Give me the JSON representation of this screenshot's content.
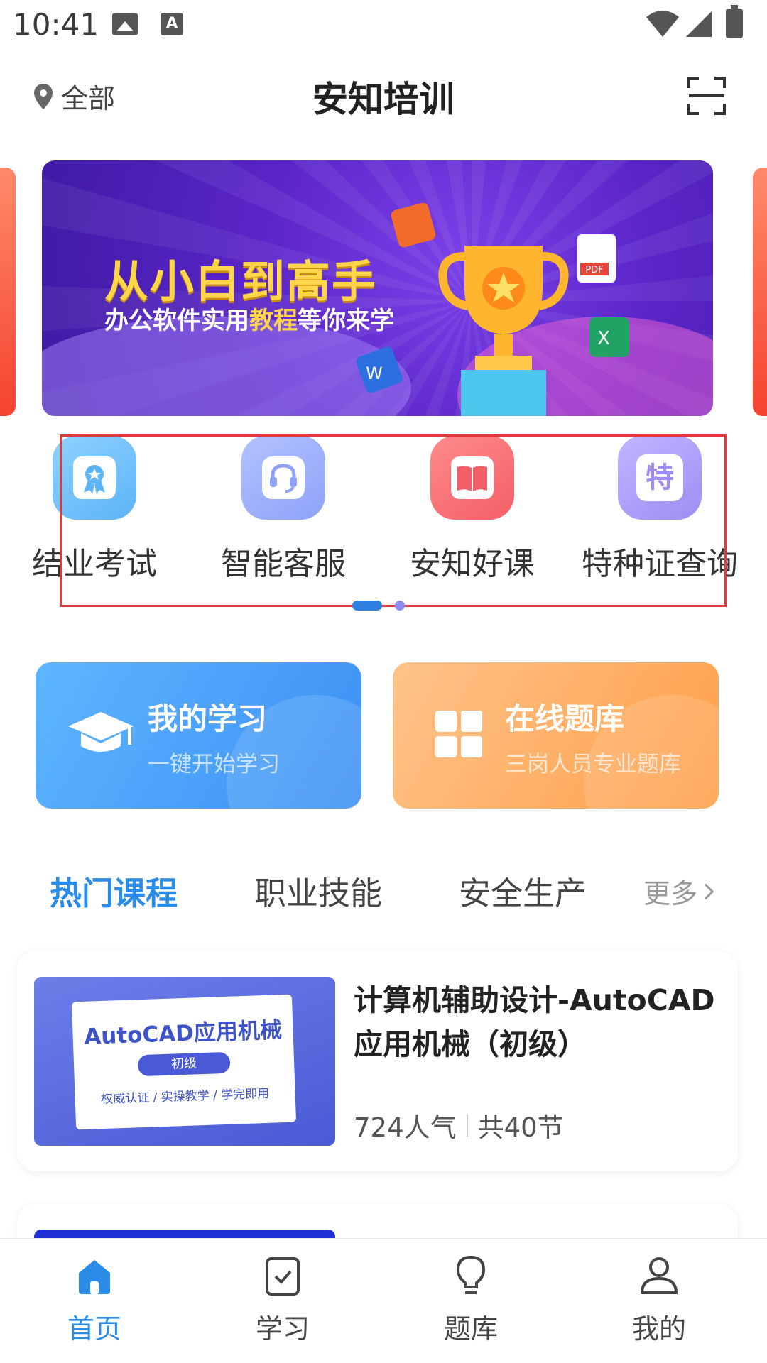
{
  "status_bar": {
    "time": "10:41",
    "a_label": "A"
  },
  "header": {
    "location": "全部",
    "title": "安知培训"
  },
  "banner": {
    "headline": "从小白到高手",
    "sub_part1": "办公软件实用",
    "sub_highlight": "教程",
    "sub_part2": "等你来学",
    "icon_labels": {
      "pdf": "PDF",
      "excel": "X",
      "word": "W"
    }
  },
  "quick_entries": [
    {
      "label": "结业考试",
      "icon": "award-ribbon-icon"
    },
    {
      "label": "智能客服",
      "icon": "headset-icon"
    },
    {
      "label": "安知好课",
      "icon": "open-book-icon"
    },
    {
      "label": "特种证查询",
      "icon": "special-cert-icon",
      "glyph": "特"
    }
  ],
  "feature_cards": {
    "learn": {
      "title": "我的学习",
      "subtitle": "一键开始学习"
    },
    "bank": {
      "title": "在线题库",
      "subtitle": "三岗人员专业题库"
    }
  },
  "tabs": {
    "items": [
      "热门课程",
      "职业技能",
      "安全生产"
    ],
    "active_index": 0,
    "more": "更多"
  },
  "courses": [
    {
      "title": "计算机辅助设计-AutoCAD应用机械（初级）",
      "thumb_title": "AutoCAD应用机械",
      "thumb_level": "初级",
      "thumb_sub": "权威认证 / 实操教学 / 学完即用",
      "popularity": "724人气",
      "lessons": "共40节"
    }
  ],
  "bottom_nav": [
    {
      "label": "首页",
      "active": true
    },
    {
      "label": "学习"
    },
    {
      "label": "题库"
    },
    {
      "label": "我的"
    }
  ],
  "colors": {
    "accent": "#2a8ce6",
    "annotation": "#e0393e"
  }
}
